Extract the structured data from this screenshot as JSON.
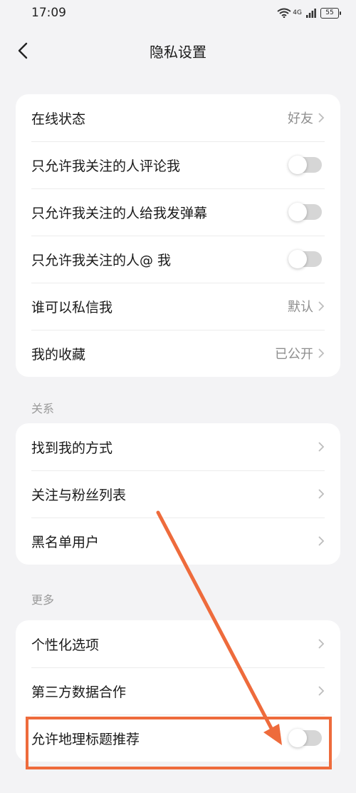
{
  "status_bar": {
    "time": "17:09",
    "network": "4G",
    "battery": "55"
  },
  "nav": {
    "title": "隐私设置"
  },
  "section1": {
    "items": [
      {
        "label": "在线状态",
        "type": "value",
        "value": "好友"
      },
      {
        "label": "只允许我关注的人评论我",
        "type": "toggle",
        "on": false
      },
      {
        "label": "只允许我关注的人给我发弹幕",
        "type": "toggle",
        "on": false
      },
      {
        "label": "只允许我关注的人@ 我",
        "type": "toggle",
        "on": false
      },
      {
        "label": "谁可以私信我",
        "type": "value",
        "value": "默认"
      },
      {
        "label": "我的收藏",
        "type": "value",
        "value": "已公开"
      }
    ]
  },
  "section2": {
    "title": "关系",
    "items": [
      {
        "label": "找到我的方式"
      },
      {
        "label": "关注与粉丝列表"
      },
      {
        "label": "黑名单用户"
      }
    ]
  },
  "section3": {
    "title": "更多",
    "items": [
      {
        "label": "个性化选项"
      },
      {
        "label": "第三方数据合作"
      },
      {
        "label": "允许地理标题推荐",
        "type": "toggle",
        "on": false
      }
    ]
  },
  "colors": {
    "annotation": "#ee6b3c",
    "toggle_off": "#d6d6d6",
    "background": "#f3f3f5"
  }
}
